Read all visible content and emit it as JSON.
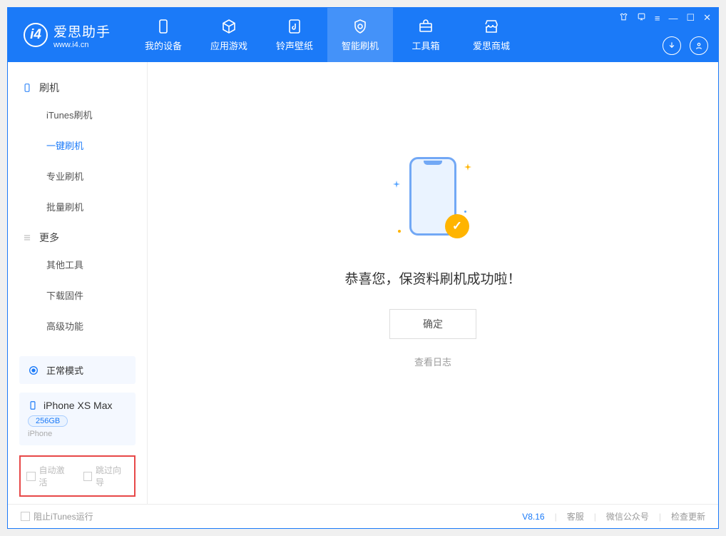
{
  "app": {
    "name": "爱思助手",
    "url": "www.i4.cn"
  },
  "nav": {
    "items": [
      {
        "label": "我的设备"
      },
      {
        "label": "应用游戏"
      },
      {
        "label": "铃声壁纸"
      },
      {
        "label": "智能刷机"
      },
      {
        "label": "工具箱"
      },
      {
        "label": "爱思商城"
      }
    ]
  },
  "sidebar": {
    "section1": "刷机",
    "items1": [
      {
        "label": "iTunes刷机"
      },
      {
        "label": "一键刷机"
      },
      {
        "label": "专业刷机"
      },
      {
        "label": "批量刷机"
      }
    ],
    "section2": "更多",
    "items2": [
      {
        "label": "其他工具"
      },
      {
        "label": "下载固件"
      },
      {
        "label": "高级功能"
      }
    ],
    "mode": "正常模式",
    "device": {
      "name": "iPhone XS Max",
      "capacity": "256GB",
      "type": "iPhone"
    },
    "opts": {
      "auto_activate": "自动激活",
      "skip_guide": "跳过向导"
    }
  },
  "main": {
    "message": "恭喜您，保资料刷机成功啦！",
    "ok": "确定",
    "viewlog": "查看日志"
  },
  "footer": {
    "block_itunes": "阻止iTunes运行",
    "version": "V8.16",
    "support": "客服",
    "wechat": "微信公众号",
    "update": "检查更新"
  }
}
